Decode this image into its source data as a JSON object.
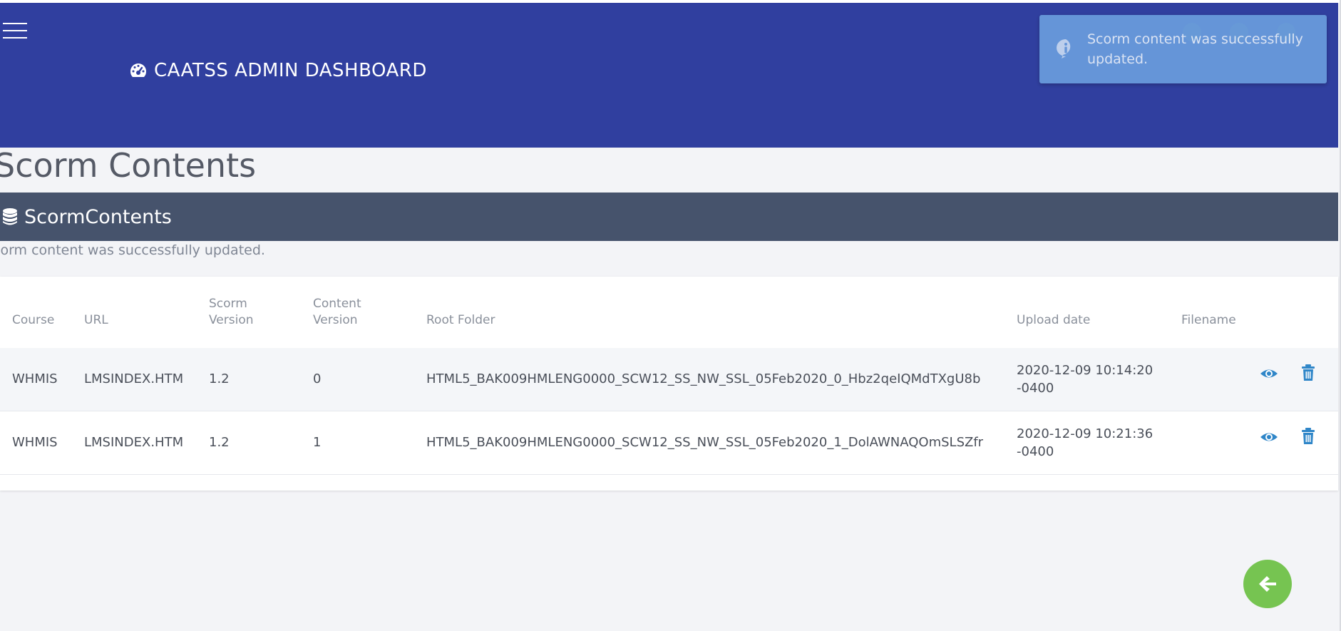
{
  "header": {
    "title": "CAATSS ADMIN DASHBOARD",
    "dash_icon": "dashboard-icon",
    "menu_icon": "hamburger-icon",
    "color": "#303f9f"
  },
  "toast": {
    "message": "Scorm content was successfully updated.",
    "icon": "info-icon",
    "color": "#6a9ddd"
  },
  "page": {
    "title": "Scorm Contents"
  },
  "section": {
    "title": "ScormContents",
    "icon": "database-icon",
    "color": "#46536c"
  },
  "notice": "corm content was successfully updated.",
  "table": {
    "headers": {
      "course": "Course",
      "url": "URL",
      "scorm_version": [
        "Scorm",
        "Version"
      ],
      "content_version": [
        "Content",
        "Version"
      ],
      "root_folder": "Root Folder",
      "upload_date": "Upload date",
      "filename": "Filename"
    },
    "rows": [
      {
        "course": "WHMIS",
        "url": "LMSINDEX.HTM",
        "scorm_version": "1.2",
        "content_version": "0",
        "root_folder": "HTML5_BAK009HMLENG0000_SCW12_SS_NW_SSL_05Feb2020_0_Hbz2qeIQMdTXgU8b",
        "upload_date": [
          "2020-12-09 10:14:20",
          "-0400"
        ],
        "filename": ""
      },
      {
        "course": "WHMIS",
        "url": "LMSINDEX.HTM",
        "scorm_version": "1.2",
        "content_version": "1",
        "root_folder": "HTML5_BAK009HMLENG0000_SCW12_SS_NW_SSL_05Feb2020_1_DolAWNAQOmSLSZfr",
        "upload_date": [
          "2020-12-09 10:21:36",
          "-0400"
        ],
        "filename": ""
      }
    ],
    "action_icons": [
      "eye-icon",
      "trash-icon"
    ],
    "action_color": "#2f86c8"
  },
  "back_button": {
    "icon": "arrow-left-icon",
    "color": "#76c451"
  }
}
